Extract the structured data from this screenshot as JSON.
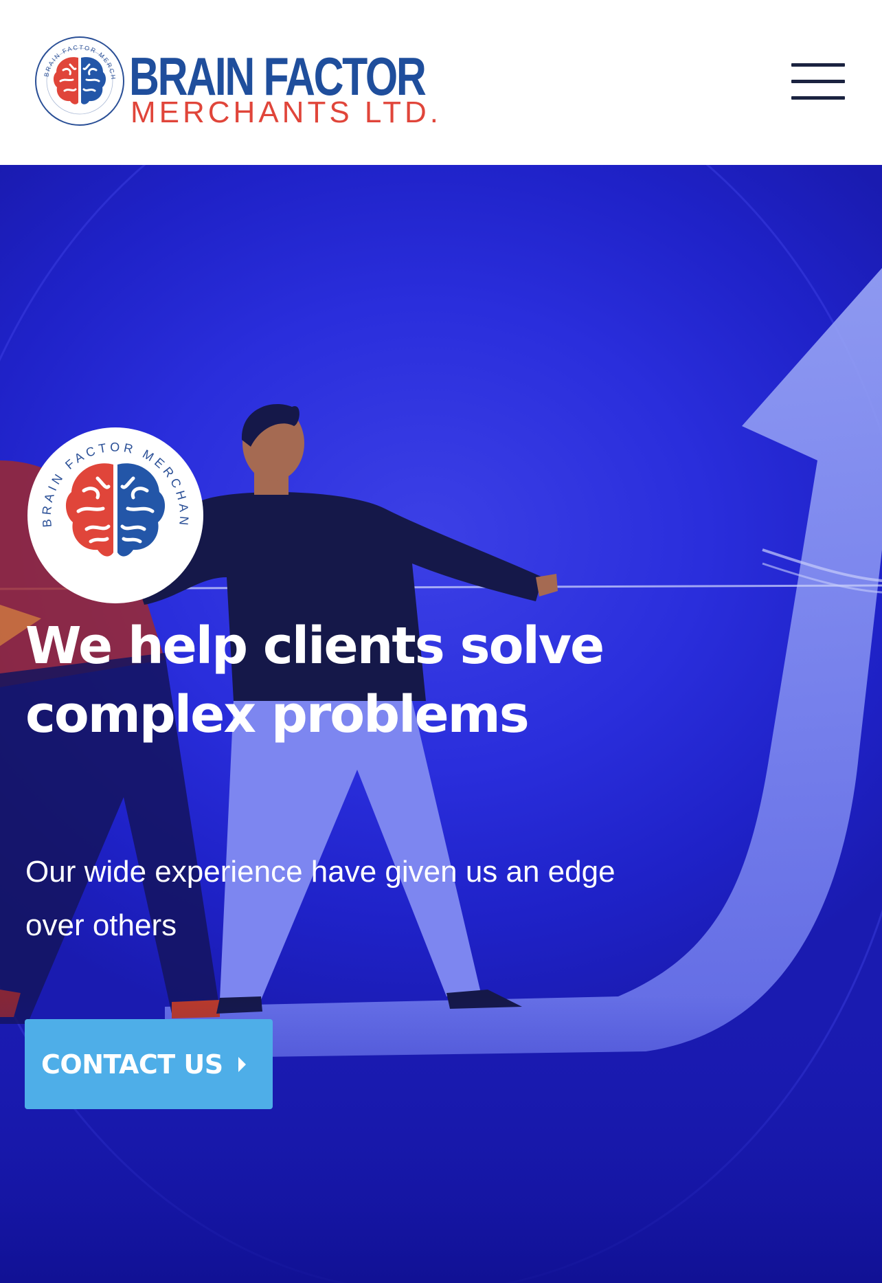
{
  "header": {
    "logo": {
      "name_line1": "BRAIN FACTOR",
      "name_line2": "MERCHANTS LTD.",
      "seal_text": "BRAIN FACTOR MERCHANTS LTD."
    },
    "menu_icon": "hamburger-menu-icon"
  },
  "hero": {
    "seal_text": "BRAIN FACTOR MERCHANTS LTD.",
    "title": "We help clients solve complex problems",
    "subtitle": "Our wide experience have given us an edge over others",
    "cta_label": "CONTACT US",
    "cta_icon": "caret-right-icon"
  },
  "colors": {
    "brand_blue": "#1f4e9c",
    "brand_red": "#e0453a",
    "hero_bg": "#2a2edc",
    "cta_bg": "#4eaee8",
    "menu_bars": "#1b2340"
  }
}
